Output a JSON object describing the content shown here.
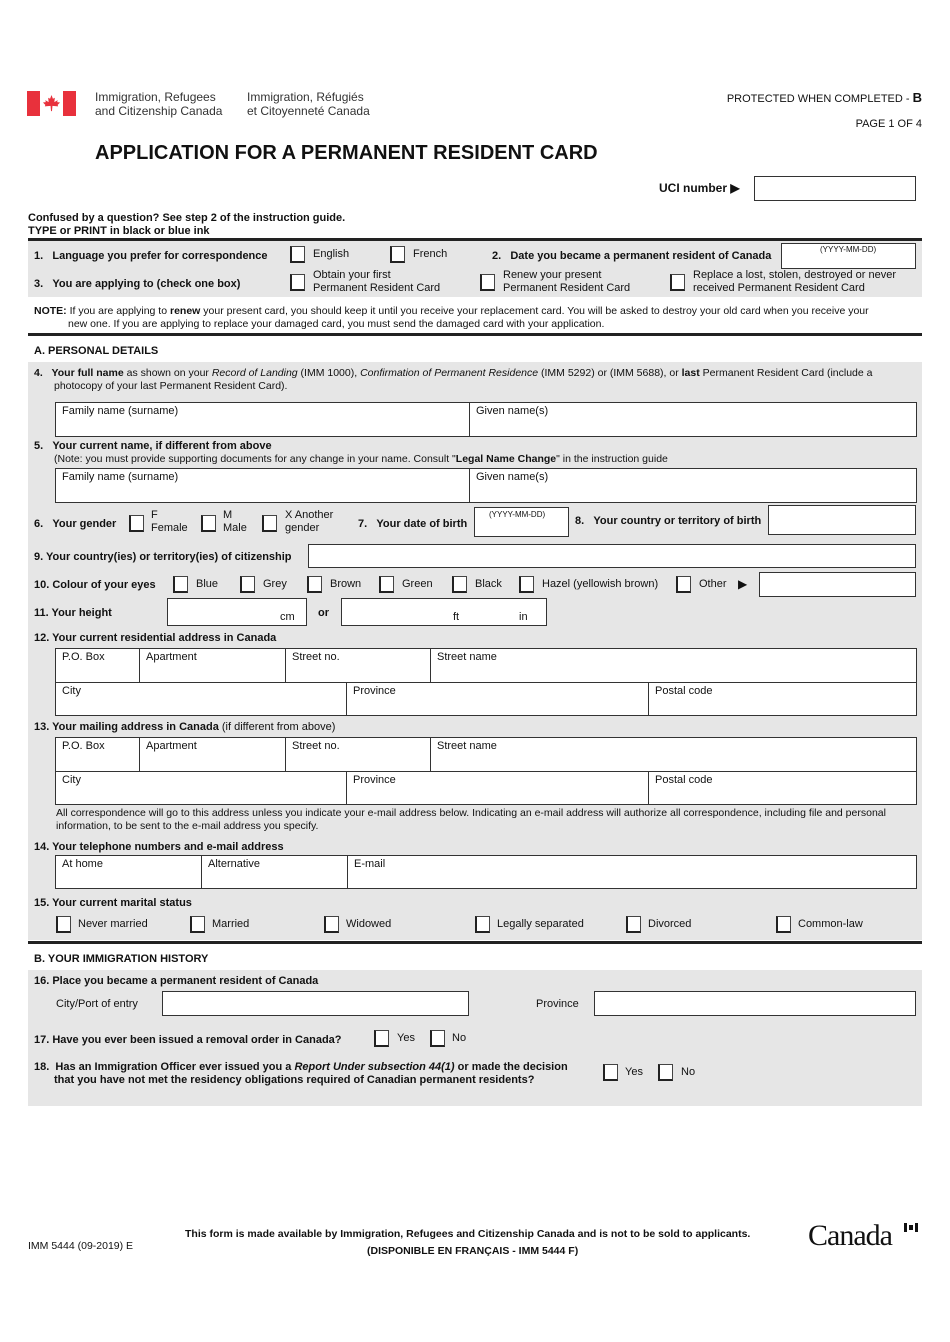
{
  "header": {
    "dept_en_line1": "Immigration, Refugees",
    "dept_en_line2": "and Citizenship Canada",
    "dept_fr_line1": "Immigration, Réfugiés",
    "dept_fr_line2": "et Citoyenneté Canada",
    "protected": "PROTECTED WHEN COMPLETED - ",
    "protected_level": "B",
    "page": "PAGE 1 OF 4",
    "title": "APPLICATION FOR A PERMANENT RESIDENT CARD",
    "uci_label": "UCI number",
    "uci_value": "",
    "instructions_1": "Confused by a question? See step 2 of the instruction guide.",
    "instructions_2": "TYPE or PRINT in black or blue ink",
    "flag_color": "#e8313c"
  },
  "top": {
    "q1_num": "1.",
    "q1_label": "Language you prefer for correspondence",
    "q1_options": [
      "English",
      "French"
    ],
    "q2_num": "2.",
    "q2_label": "Date you became a permanent resident of Canada",
    "date_hint": "(YYYY-MM-DD)",
    "q3_num": "3.",
    "q3_label": "You are applying to (check one box)",
    "q3_options": [
      {
        "line1": "Obtain your first",
        "line2": "Permanent Resident Card"
      },
      {
        "line1": "Renew your present",
        "line2": "Permanent Resident Card"
      },
      {
        "line1": "Replace a lost, stolen, destroyed or never",
        "line2": "received Permanent Resident Card"
      }
    ],
    "note_label": "NOTE:",
    "note_a": " If you are applying to ",
    "note_bold": "renew",
    "note_b": " your present card, you should keep it until you receive your replacement card. You will be asked to destroy your old card when you receive your",
    "note_c": "new one. If you are applying to replace your damaged card, you must send the damaged card with your application."
  },
  "sectionA": {
    "title": "A.   PERSONAL DETAILS",
    "q4_num": "4.",
    "q4_bold": "Your full name",
    "q4_a": " as shown on your ",
    "q4_it1": "Record of Landing",
    "q4_b": " (IMM 1000), ",
    "q4_it2": "Confirmation of Permanent Residence",
    "q4_c": " (IMM 5292) or (IMM 5688), or ",
    "q4_bold2": "last",
    "q4_d": " Permanent Resident Card (include a",
    "q4_e": "photocopy of your last Permanent Resident Card).",
    "family_name": "Family name (surname)",
    "given_names": "Given name(s)",
    "q5_num": "5.",
    "q5_label": "Your current name, if different from above",
    "q5_note_a": "(Note: you must provide supporting documents for any change in your name. Consult \"",
    "q5_note_bold": "Legal Name Change",
    "q5_note_b": "\" in the instruction guide",
    "q6_num": "6.",
    "q6_label": "Your gender",
    "gender_options": [
      {
        "line1": "F",
        "line2": "Female"
      },
      {
        "line1": "M",
        "line2": "Male"
      },
      {
        "line1": "X Another",
        "line2": "gender"
      }
    ],
    "q7_num": "7.",
    "q7_label": "Your date of birth",
    "q8_num": "8.",
    "q8_label": "Your country or territory of birth",
    "q9_label": "9.  Your country(ies) or territory(ies) of citizenship",
    "q10_label": "10.  Colour of your eyes",
    "eye_options": [
      "Blue",
      "Grey",
      "Brown",
      "Green",
      "Black",
      "Hazel (yellowish brown)",
      "Other"
    ],
    "q11_label": "11.  Your height",
    "cm": "cm",
    "or": "or",
    "ft": "ft",
    "in": "in",
    "q12_label": "12.  Your current residential address in Canada",
    "q13_label_bold": "13.  Your mailing address in Canada",
    "q13_label_rest": " (if different from above)",
    "address_fields_row1": [
      "P.O. Box",
      "Apartment",
      "Street no.",
      "Street name"
    ],
    "address_fields_row2": [
      "City",
      "Province",
      "Postal code"
    ],
    "correspondence_note_1": "All correspondence will go to this address unless you indicate your e-mail address below. Indicating an e-mail address will authorize all correspondence, including file and personal",
    "correspondence_note_2": "information, to be sent to the e-mail address you specify.",
    "q14_label": "14.  Your telephone numbers and e-mail address",
    "contact_fields": [
      "At home",
      "Alternative",
      "E-mail"
    ],
    "q15_label": "15.  Your current marital status",
    "marital_options": [
      "Never married",
      "Married",
      "Widowed",
      "Legally separated",
      "Divorced",
      "Common-law"
    ]
  },
  "sectionB": {
    "title": "B.   YOUR IMMIGRATION HISTORY",
    "q16_label": "16.  Place you became a permanent resident of Canada",
    "city_port": "City/Port of entry",
    "province": "Province",
    "q17_label": "17.  Have you ever been issued a removal order in Canada?",
    "q18_num": "18.",
    "q18_a": "Has an Immigration Officer ever issued you a ",
    "q18_it": "Report Under subsection 44(1)",
    "q18_b": " or made the decision",
    "q18_c": "that you have not met the residency obligations required of Canadian permanent residents?",
    "yes": "Yes",
    "no": "No"
  },
  "footer": {
    "form_code": "IMM 5444 (09-2019) E",
    "notice": "This form is made available by Immigration, Refugees and Citizenship Canada and is not to be sold to applicants.",
    "french": "(DISPONIBLE EN FRANÇAIS - IMM 5444 F)",
    "wordmark": "Canada"
  }
}
